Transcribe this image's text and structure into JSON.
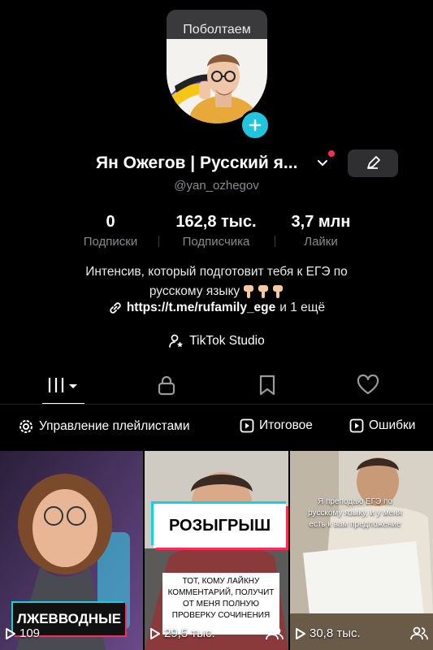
{
  "tooltip": {
    "text": "Поболтаем"
  },
  "profile": {
    "display_name": "Ян Ожегов | Русский я...",
    "handle": "@yan_ozhegov",
    "avatar_icon": "profile-photo",
    "add_icon": "plus-icon",
    "edit_icon": "pencil-icon"
  },
  "stats": [
    {
      "value": "0",
      "label": "Подписки"
    },
    {
      "value": "162,8 тыс.",
      "label": "Подписчика"
    },
    {
      "value": "3,7 млн",
      "label": "Лайки"
    }
  ],
  "bio": {
    "line1": "Интенсив, который подготовит тебя к ЕГЭ по",
    "line2": "русскому языку"
  },
  "link": {
    "url": "https://t.me/rufamily_ege",
    "extra": "и 1 ещё"
  },
  "studio": {
    "label": "TikTok Studio"
  },
  "tabs": [
    {
      "name": "videos",
      "icon": "grid-icon"
    },
    {
      "name": "private",
      "icon": "lock-icon"
    },
    {
      "name": "favorites",
      "icon": "bookmark-icon"
    },
    {
      "name": "liked",
      "icon": "heart-icon"
    }
  ],
  "playlists": [
    {
      "label": "Управление плейлистами",
      "icon": "gear-icon"
    },
    {
      "label": "Итоговое",
      "icon": "playlist-icon"
    },
    {
      "label": "Ошибки",
      "icon": "playlist-icon"
    }
  ],
  "videos": [
    {
      "caption": "ЛЖЕВВОДНЫЕ",
      "views": "109"
    },
    {
      "caption": "РОЗЫГРЫШ",
      "sub": "ТОТ, КОМУ ЛАЙКНУ КОММЕНТАРИЙ, ПОЛУЧИТ ОТ МЕНЯ ПОЛНУЮ ПРОВЕРКУ СОЧИНЕНИЯ",
      "views": "29,5 тыс."
    },
    {
      "caption": "Я преподаю ЕГЭ по русскому языку, и у меня есть к вам предложение",
      "views": "30,8 тыс."
    }
  ],
  "colors": {
    "accent": "#20c4de",
    "notification": "#fe2c55",
    "background": "#000000"
  }
}
